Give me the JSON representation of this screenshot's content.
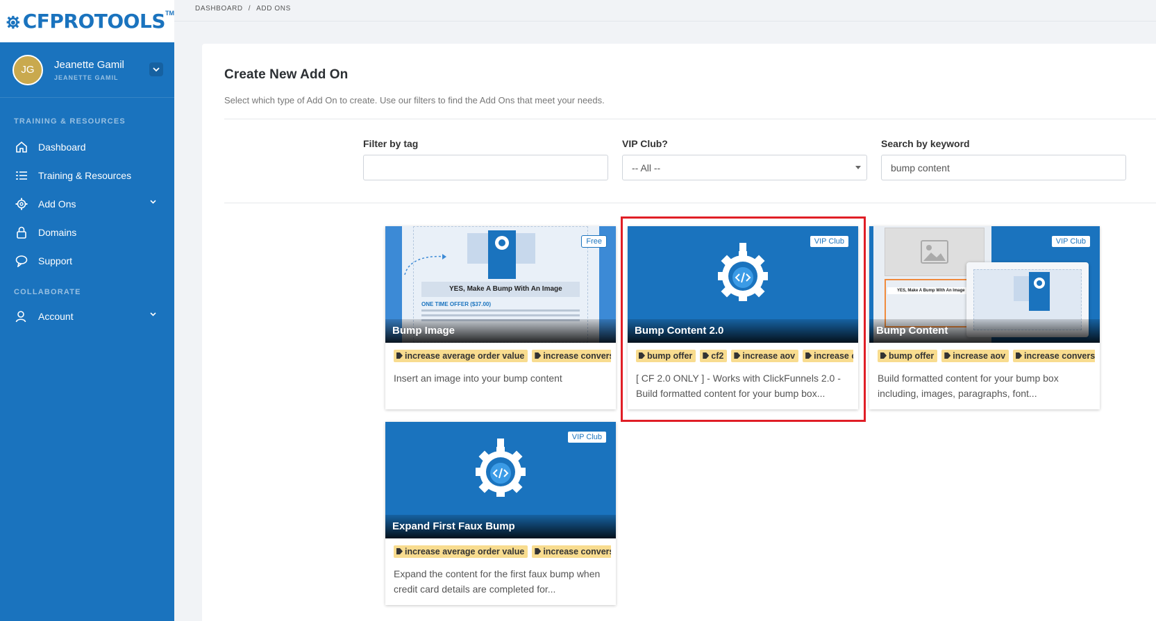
{
  "brand": {
    "logo_text": "CFPROTOOLS",
    "logo_tm": "TM",
    "accent": "#1a73be"
  },
  "user": {
    "initials": "JG",
    "name": "Jeanette Gamil",
    "subname": "JEANETTE GAMIL"
  },
  "sidebar": {
    "section1": "TRAINING & RESOURCES",
    "section2": "COLLABORATE",
    "items": [
      {
        "label": "Dashboard",
        "icon": "home-icon"
      },
      {
        "label": "Training & Resources",
        "icon": "list-icon"
      },
      {
        "label": "Add Ons",
        "icon": "gear-icon"
      },
      {
        "label": "Domains",
        "icon": "lock-icon"
      },
      {
        "label": "Support",
        "icon": "chat-icon"
      },
      {
        "label": "Account",
        "icon": "user-icon"
      }
    ]
  },
  "breadcrumb": {
    "root": "DASHBOARD",
    "sep": "/",
    "current": "ADD ONS"
  },
  "page": {
    "title": "Create New Add On",
    "subtitle": "Select which type of Add On to create. Use our filters to find the Add Ons that meet your needs."
  },
  "filters": {
    "tag": {
      "label": "Filter by tag",
      "value": ""
    },
    "vip": {
      "label": "VIP Club?",
      "value": "-- All --"
    },
    "keyword": {
      "label": "Search by keyword",
      "value": "bump content"
    }
  },
  "cards": [
    {
      "title": "Bump Image",
      "badge": "Free",
      "tags": [
        "increase average order value",
        "increase conversions"
      ],
      "description": "Insert an image into your bump content",
      "preview": {
        "headline": "YES, Make A Bump With An Image",
        "offer": "ONE TIME OFFER ($37.00)"
      }
    },
    {
      "title": "Bump Content 2.0",
      "badge": "VIP Club",
      "tags": [
        "bump offer",
        "cf2",
        "increase aov",
        "increase conversions"
      ],
      "description": "[ CF 2.0 ONLY ] - Works with ClickFunnels 2.0 - Build formatted content for your bump box..."
    },
    {
      "title": "Bump Content",
      "badge": "VIP Club",
      "tags": [
        "bump offer",
        "increase aov",
        "increase conversions"
      ],
      "description": "Build formatted content for your bump box including, images, paragraphs, font...",
      "preview": {
        "headline": "YES, Make A Bump With An Image"
      }
    },
    {
      "title": "Expand First Faux Bump",
      "badge": "VIP Club",
      "tags": [
        "increase average order value",
        "increase conversions"
      ],
      "description": "Expand the content for the first faux bump when credit card details are completed for..."
    }
  ]
}
